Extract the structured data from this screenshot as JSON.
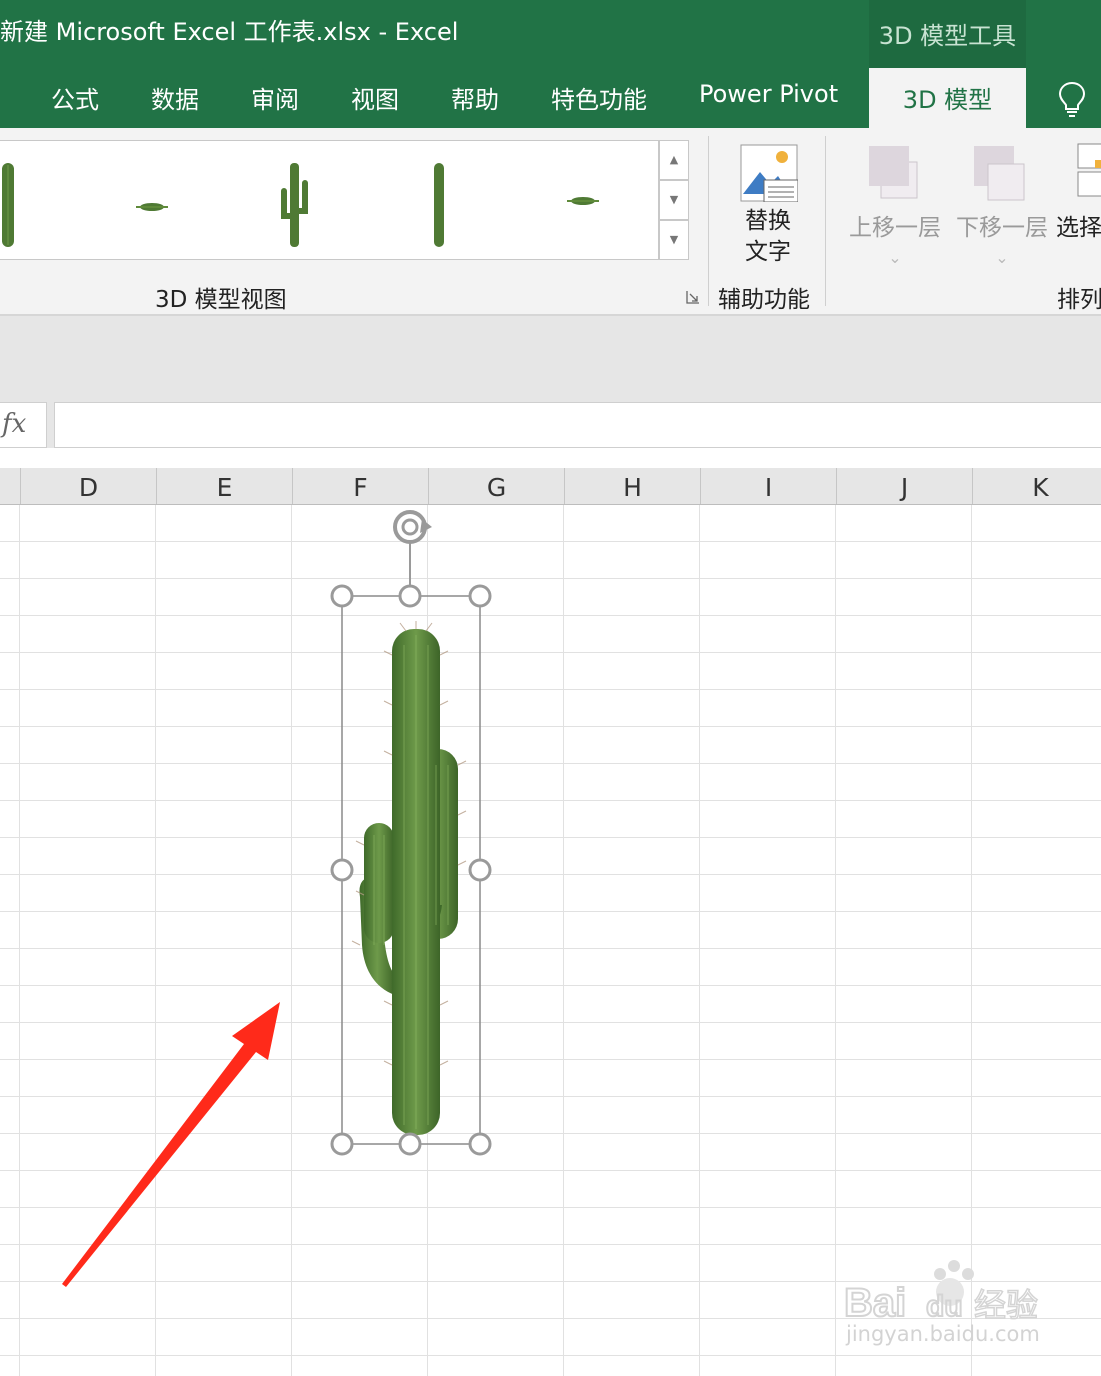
{
  "window": {
    "title": "新建 Microsoft Excel 工作表.xlsx  -  Excel",
    "context_group": "3D 模型工具"
  },
  "tabs": [
    {
      "label": "公式"
    },
    {
      "label": "数据"
    },
    {
      "label": "审阅"
    },
    {
      "label": "视图"
    },
    {
      "label": "帮助"
    },
    {
      "label": "特色功能"
    },
    {
      "label": "Power Pivot"
    }
  ],
  "active_tab": {
    "label": "3D 模型"
  },
  "ribbon": {
    "views_group_label": "3D 模型视图",
    "alt_text_line1": "替换",
    "alt_text_line2": "文字",
    "accessibility_group_label": "辅助功能",
    "bring_forward": "上移一层",
    "send_backward": "下移一层",
    "select_pane": "选择",
    "arrange_group_label": "排列",
    "chevron": "⌄"
  },
  "formula_bar": {
    "fx": "fx",
    "value": ""
  },
  "columns": [
    "D",
    "E",
    "F",
    "G",
    "H",
    "I",
    "J",
    "K"
  ],
  "icons": [
    "cactus-thumbnail-icon",
    "alt-text-icon",
    "lightbulb-icon",
    "rotate-handle-icon",
    "red-arrow-annotation"
  ],
  "colors": {
    "excel_green": "#217346",
    "annotation_red": "#ff2a1a",
    "cactus_green": "#4f7a34"
  },
  "watermark": {
    "logo": "Bai du 经验",
    "url": "jingyan.baidu.com"
  }
}
